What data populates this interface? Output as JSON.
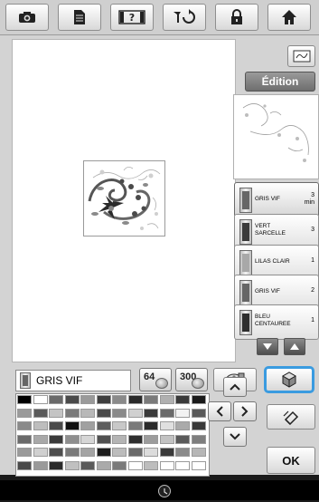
{
  "toolbar": {
    "icons": [
      "camera-icon",
      "document-icon",
      "help-icon",
      "thread-change-icon",
      "lock-icon",
      "home-icon"
    ]
  },
  "right_panel": {
    "size_icon": "size-frame-icon",
    "edition_label": "Édition",
    "color_list": [
      {
        "name": "GRIS VIF",
        "value": "3",
        "unit": "min",
        "color": "#666666",
        "selected": true
      },
      {
        "name": "VERT SARCELLE",
        "value": "3",
        "color": "#3a3a3a"
      },
      {
        "name": "LILAS CLAIR",
        "value": "1",
        "color": "#a8a8a8"
      },
      {
        "name": "GRIS VIF",
        "value": "2",
        "color": "#666666"
      },
      {
        "name": "BLEU CENTAUREE",
        "value": "1",
        "color": "#2e2e2e"
      }
    ]
  },
  "palette": {
    "current_color_name": "GRIS VIF",
    "current_color": "#666666",
    "count_64": "64",
    "count_300": "300",
    "rows": [
      [
        "#000000",
        "#ffffff",
        "#6a6a6a",
        "#4a4a4a",
        "#9a9a9a",
        "#3e3e3e",
        "#8a8a8a",
        "#2a2a2a",
        "#7a7a7a",
        "#b0b0b0",
        "#3a3a3a",
        "#1a1a1a"
      ],
      [
        "#9a9a9a",
        "#5a5a5a",
        "#c4c4c4",
        "#7a7a7a",
        "#b8b8b8",
        "#4a4a4a",
        "#8a8a8a",
        "#d0d0d0",
        "#3a3a3a",
        "#6a6a6a",
        "#f2f2f2",
        "#5a5a5a"
      ],
      [
        "#8a8a8a",
        "#bdbdbd",
        "#4a4a4a",
        "#111111",
        "#a0a0a0",
        "#5e5e5e",
        "#c8c8c8",
        "#7a7a7a",
        "#2a2a2a",
        "#e0e0e0",
        "#aaaaaa",
        "#3a3a3a"
      ],
      [
        "#6a6a6a",
        "#a8a8a8",
        "#3a3a3a",
        "#8e8e8e",
        "#d6d6d6",
        "#505050",
        "#b4b4b4",
        "#2e2e2e",
        "#9c9c9c",
        "#c2c2c2",
        "#5a5a5a",
        "#7e7e7e"
      ],
      [
        "#9a9a9a",
        "#d0d0d0",
        "#4e4e4e",
        "#7a7a7a",
        "#a4a4a4",
        "#1e1e1e",
        "#bcbcbc",
        "#6a6a6a",
        "#dcdcdc",
        "#3a3a3a",
        "#8a8a8a",
        "#b6b6b6"
      ],
      [
        "#4a4a4a",
        "#9a9a9a",
        "#2a2a2a",
        "#c0c0c0",
        "#5a5a5a",
        "#aaaaaa",
        "#7a7a7a",
        "#ffffff",
        "#bdbdbd",
        "#ffffff",
        "#ffffff",
        "#ffffff"
      ]
    ]
  },
  "actions": {
    "ok_label": "OK"
  }
}
